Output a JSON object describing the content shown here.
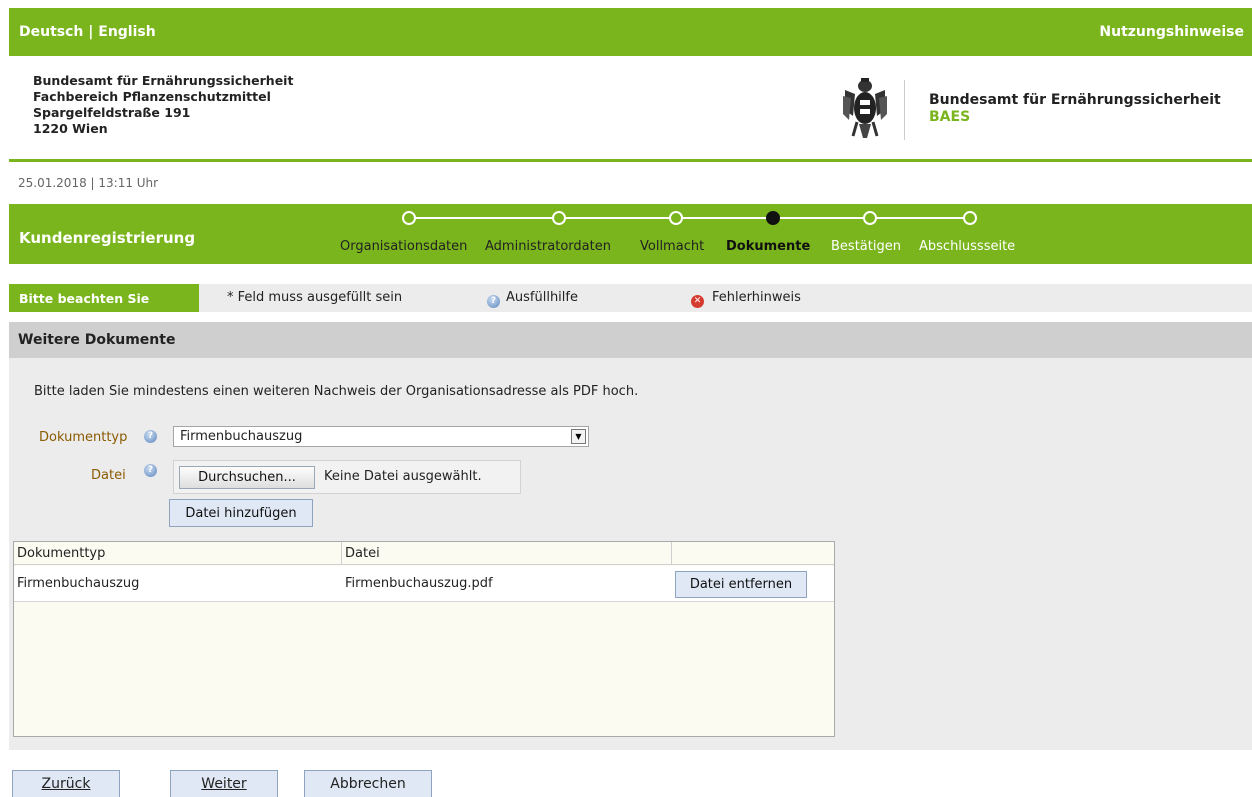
{
  "topbar": {
    "lang_de": "Deutsch",
    "lang_sep": "|",
    "lang_en": "English",
    "help": "Nutzungshinweise"
  },
  "header": {
    "address_lines": [
      "Bundesamt für Ernährungssicherheit",
      "Fachbereich Pflanzenschutzmittel",
      "Spargelfeldstraße 191",
      "1220 Wien"
    ],
    "org_name": "Bundesamt für Ernährungssicherheit",
    "org_abbr": "BAES",
    "logo_icon": "austrian-eagle-coat-of-arms"
  },
  "timestamp": "25.01.2018 | 13:11 Uhr",
  "stepbar": {
    "title": "Kundenregistrierung",
    "steps": [
      {
        "label": "Organisationsdaten",
        "state": "done"
      },
      {
        "label": "Administratordaten",
        "state": "done"
      },
      {
        "label": "Vollmacht",
        "state": "done"
      },
      {
        "label": "Dokumente",
        "state": "active"
      },
      {
        "label": "Bestätigen",
        "state": "future"
      },
      {
        "label": "Abschlussseite",
        "state": "future"
      }
    ]
  },
  "notice": {
    "label": "Bitte beachten Sie",
    "required": "* Feld muss ausgefüllt sein",
    "fill_help": "Ausfüllhilfe",
    "error_hint": "Fehlerhinweis"
  },
  "panel": {
    "title": "Weitere Dokumente",
    "intro": "Bitte laden Sie mindestens einen weiteren Nachweis der Organisationsadresse als PDF hoch.",
    "doc_type_label": "Dokumenttyp",
    "doc_type_value": "Firmenbuchauszug",
    "file_label": "Datei",
    "browse_button": "Durchsuchen...",
    "no_file": "Keine Datei ausgewählt.",
    "add_file_button": "Datei hinzufügen"
  },
  "table": {
    "columns": [
      "Dokumenttyp",
      "Datei",
      ""
    ],
    "rows": [
      {
        "doc_type": "Firmenbuchauszug",
        "file": "Firmenbuchauszug.pdf",
        "action": "Datei entfernen"
      }
    ]
  },
  "nav": {
    "back": "Zurück",
    "next": "Weiter",
    "cancel": "Abbrechen"
  },
  "colors": {
    "brand_green": "#7ab51d",
    "panel_gray": "#ececec",
    "label_brown": "#8a5a00",
    "error_red": "#d63b2f"
  }
}
